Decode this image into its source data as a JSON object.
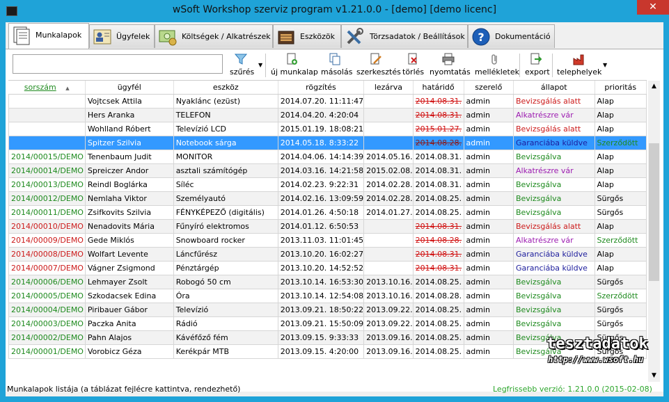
{
  "window": {
    "title": "wSoft Workshop szerviz program v1.21.0.0 - [demo] [demo licenc]",
    "close_glyph": "✕"
  },
  "tabs": [
    {
      "label": "Munkalapok",
      "icon": "worksheet-icon",
      "active": true
    },
    {
      "label": "Ügyfelek",
      "icon": "customer-card-icon",
      "active": false
    },
    {
      "label": "Költségek / Alkatrészek",
      "icon": "costs-icon",
      "active": false
    },
    {
      "label": "Eszközök",
      "icon": "toolbox-icon",
      "active": false
    },
    {
      "label": "Törzsadatok / Beállítások",
      "icon": "tools-settings-icon",
      "active": false
    },
    {
      "label": "Dokumentáció",
      "icon": "help-icon",
      "active": false
    }
  ],
  "toolbar": {
    "search_value": "",
    "filter": "szűrés",
    "new": "új munkalap",
    "copy": "másolás",
    "edit": "szerkesztés",
    "delete": "törlés",
    "print": "nyomtatás",
    "attachments": "mellékletek",
    "export": "export",
    "sites": "telephelyek"
  },
  "table": {
    "columns": [
      "sorszám",
      "ügyfél",
      "eszköz",
      "rögzítés",
      "lezárva",
      "határidő",
      "szerelő",
      "állapot",
      "prioritás"
    ],
    "sort_column": "sorszám",
    "rows": [
      {
        "id": "",
        "customer": "Vojtcsek Attila",
        "device": "Nyaklánc (ezüst)",
        "recorded": "2014.07.20. 11:11:47",
        "closed": "",
        "deadline": "2014.08.31.",
        "deadline_overdue": true,
        "tech": "admin",
        "status": "Bevizsgálás alatt",
        "status_color": "red",
        "priority": "Alap",
        "priority_color": "black",
        "id_color": "green"
      },
      {
        "id": "",
        "customer": "Hers Aranka",
        "device": "TELEFON",
        "recorded": "2014.04.20. 4:20:04",
        "closed": "",
        "deadline": "2014.08.31.",
        "deadline_overdue": true,
        "tech": "admin",
        "status": "Alkatrészre vár",
        "status_color": "purple",
        "priority": "Alap",
        "priority_color": "black",
        "id_color": "green"
      },
      {
        "id": "",
        "customer": "Wohlland Róbert",
        "device": "Televízió LCD",
        "recorded": "2015.01.19. 18:08:21",
        "closed": "",
        "deadline": "2015.01.27.",
        "deadline_overdue": true,
        "tech": "admin",
        "status": "Bevizsgálás alatt",
        "status_color": "red",
        "priority": "Alap",
        "priority_color": "black",
        "id_color": "green"
      },
      {
        "id": "",
        "customer": "Spitzer Szilvia",
        "device": "Notebook sárga",
        "recorded": "2014.05.18. 8:33:22",
        "closed": "",
        "deadline": "2014.08.28.",
        "deadline_overdue": true,
        "tech": "admin",
        "status": "Garanciába küldve",
        "status_color": "navy",
        "priority": "Szerződött",
        "priority_color": "green",
        "id_color": "green",
        "selected": true
      },
      {
        "id": "2014/00015/DEMO",
        "customer": "Tenenbaum Judit",
        "device": "MONITOR",
        "recorded": "2014.04.06. 14:14:39",
        "closed": "2014.05.16.",
        "deadline": "2014.08.31.",
        "deadline_overdue": false,
        "tech": "admin",
        "status": "Bevizsgálva",
        "status_color": "green",
        "priority": "Alap",
        "priority_color": "black",
        "id_color": "green"
      },
      {
        "id": "2014/00014/DEMO",
        "customer": "Spreiczer Andor",
        "device": "asztali számítógép",
        "recorded": "2014.03.16. 14:21:58",
        "closed": "2015.02.08.",
        "deadline": "2014.08.31.",
        "deadline_overdue": false,
        "tech": "admin",
        "status": "Alkatrészre vár",
        "status_color": "purple",
        "priority": "Alap",
        "priority_color": "black",
        "id_color": "green"
      },
      {
        "id": "2014/00013/DEMO",
        "customer": "Reindl Boglárka",
        "device": "Síléc",
        "recorded": "2014.02.23. 9:22:31",
        "closed": "2014.02.28.",
        "deadline": "2014.08.31.",
        "deadline_overdue": false,
        "tech": "admin",
        "status": "Bevizsgálva",
        "status_color": "green",
        "priority": "Alap",
        "priority_color": "black",
        "id_color": "green"
      },
      {
        "id": "2014/00012/DEMO",
        "customer": "Nemlaha Viktor",
        "device": "Személyautó",
        "recorded": "2014.02.16. 13:09:59",
        "closed": "2014.02.28.",
        "deadline": "2014.08.25.",
        "deadline_overdue": false,
        "tech": "admin",
        "status": "Bevizsgálva",
        "status_color": "green",
        "priority": "Sürgős",
        "priority_color": "black",
        "id_color": "green"
      },
      {
        "id": "2014/00011/DEMO",
        "customer": "Zsifkovits Szilvia",
        "device": "FÉNYKÉPEZŐ (digitális)",
        "recorded": "2014.01.26. 4:50:18",
        "closed": "2014.01.27.",
        "deadline": "2014.08.25.",
        "deadline_overdue": false,
        "tech": "admin",
        "status": "Bevizsgálva",
        "status_color": "green",
        "priority": "Sürgős",
        "priority_color": "black",
        "id_color": "green"
      },
      {
        "id": "2014/00010/DEMO",
        "customer": "Nenadovits Mária",
        "device": "Fűnyíró elektromos",
        "recorded": "2014.01.12. 6:50:53",
        "closed": "",
        "deadline": "2014.08.31.",
        "deadline_overdue": true,
        "tech": "admin",
        "status": "Bevizsgálás alatt",
        "status_color": "red",
        "priority": "Alap",
        "priority_color": "black",
        "id_color": "red"
      },
      {
        "id": "2014/00009/DEMO",
        "customer": "Gede Miklós",
        "device": "Snowboard rocker",
        "recorded": "2013.11.03. 11:01:45",
        "closed": "",
        "deadline": "2014.08.28.",
        "deadline_overdue": true,
        "tech": "admin",
        "status": "Alkatrészre vár",
        "status_color": "purple",
        "priority": "Szerződött",
        "priority_color": "green",
        "id_color": "red"
      },
      {
        "id": "2014/00008/DEMO",
        "customer": "Wolfart Levente",
        "device": "Láncfűrész",
        "recorded": "2013.10.20. 16:02:27",
        "closed": "",
        "deadline": "2014.08.31.",
        "deadline_overdue": true,
        "tech": "admin",
        "status": "Garanciába küldve",
        "status_color": "navy",
        "priority": "Alap",
        "priority_color": "black",
        "id_color": "red"
      },
      {
        "id": "2014/00007/DEMO",
        "customer": "Vágner Zsigmond",
        "device": "Pénztárgép",
        "recorded": "2013.10.20. 14:52:52",
        "closed": "",
        "deadline": "2014.08.31.",
        "deadline_overdue": true,
        "tech": "admin",
        "status": "Garanciába küldve",
        "status_color": "navy",
        "priority": "Alap",
        "priority_color": "black",
        "id_color": "red"
      },
      {
        "id": "2014/00006/DEMO",
        "customer": "Lehmayer Zsolt",
        "device": "Robogó 50 cm",
        "recorded": "2013.10.14. 16:53:30",
        "closed": "2013.10.16.",
        "deadline": "2014.08.25.",
        "deadline_overdue": false,
        "tech": "admin",
        "status": "Bevizsgálva",
        "status_color": "green",
        "priority": "Sürgős",
        "priority_color": "black",
        "id_color": "green"
      },
      {
        "id": "2014/00005/DEMO",
        "customer": "Szkodacsek Edina",
        "device": "Óra",
        "recorded": "2013.10.14. 12:54:08",
        "closed": "2013.10.16.",
        "deadline": "2014.08.28.",
        "deadline_overdue": false,
        "tech": "admin",
        "status": "Bevizsgálva",
        "status_color": "green",
        "priority": "Szerződött",
        "priority_color": "green",
        "id_color": "green"
      },
      {
        "id": "2014/00004/DEMO",
        "customer": "Piribauer Gábor",
        "device": "Televízió",
        "recorded": "2013.09.21. 18:50:22",
        "closed": "2013.09.22.",
        "deadline": "2014.08.25.",
        "deadline_overdue": false,
        "tech": "admin",
        "status": "Bevizsgálva",
        "status_color": "green",
        "priority": "Sürgős",
        "priority_color": "black",
        "id_color": "green"
      },
      {
        "id": "2014/00003/DEMO",
        "customer": "Paczka Anita",
        "device": "Rádió",
        "recorded": "2013.09.21. 15:50:09",
        "closed": "2013.09.22.",
        "deadline": "2014.08.25.",
        "deadline_overdue": false,
        "tech": "admin",
        "status": "Bevizsgálva",
        "status_color": "green",
        "priority": "Sürgős",
        "priority_color": "black",
        "id_color": "green"
      },
      {
        "id": "2014/00002/DEMO",
        "customer": "Pahn Alajos",
        "device": "Kávéfőző fém",
        "recorded": "2013.09.15. 9:33:33",
        "closed": "2013.09.16.",
        "deadline": "2014.08.25.",
        "deadline_overdue": false,
        "tech": "admin",
        "status": "Bevizsgálva",
        "status_color": "green",
        "priority": "Sürgős",
        "priority_color": "black",
        "id_color": "green"
      },
      {
        "id": "2014/00001/DEMO",
        "customer": "Vorobicz Géza",
        "device": "Kerékpár MTB",
        "recorded": "2013.09.15. 4:20:00",
        "closed": "2013.09.16.",
        "deadline": "2014.08.25.",
        "deadline_overdue": false,
        "tech": "admin",
        "status": "Bevizsgálva",
        "status_color": "green",
        "priority": "Sürgős",
        "priority_color": "black",
        "id_color": "green"
      }
    ]
  },
  "statusbar": {
    "left": "Munkalapok listája (a táblázat fejlécre kattintva, rendezhető)",
    "right": "Legfrissebb verzió: 1.21.0.0 (2015-02-08)"
  },
  "watermark": {
    "line1": "tesztadatok",
    "line2": "http://www.wsoft.hu"
  }
}
